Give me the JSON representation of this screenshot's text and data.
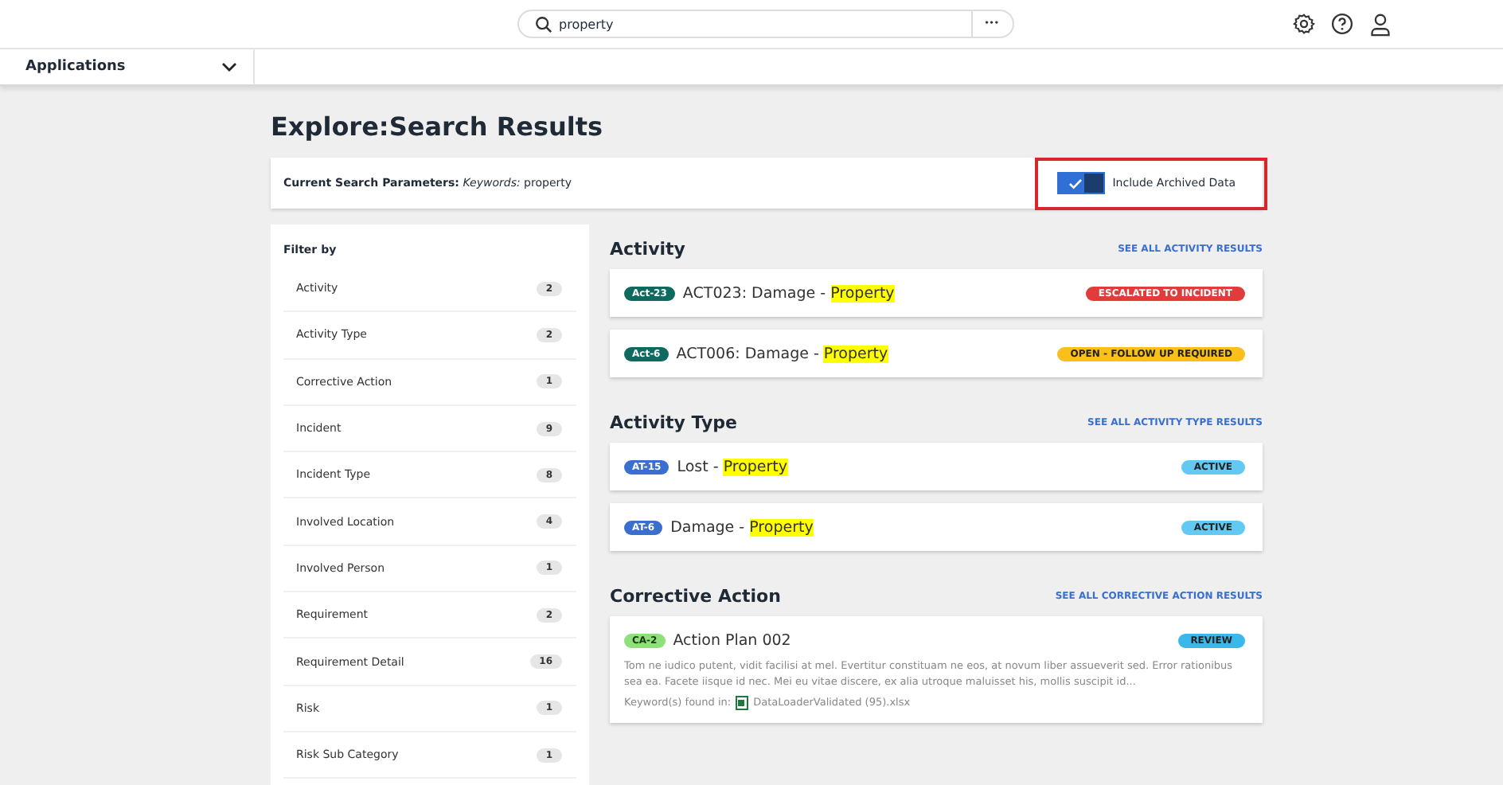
{
  "top_bar": {
    "search": {
      "value": "property",
      "more": "•••"
    }
  },
  "nav": {
    "applications": "Applications"
  },
  "page_title": "Explore:Search Results",
  "search_parameters": {
    "text": "**Current Search Parameters:** *Keywords:* property",
    "toggle": {
      "label": "Include Archived Data",
      "on": true,
      "highlighted": true
    }
  },
  "filter": {
    "title": "Filter by",
    "items": [
      {
        "label": "Activity",
        "count": "2"
      },
      {
        "label": "Activity Type",
        "count": "2"
      },
      {
        "label": "Corrective Action",
        "count": "1"
      },
      {
        "label": "Incident",
        "count": "9"
      },
      {
        "label": "Incident Type",
        "count": "8"
      },
      {
        "label": "Involved Location",
        "count": "4"
      },
      {
        "label": "Involved Person",
        "count": "1"
      },
      {
        "label": "Requirement",
        "count": "2"
      },
      {
        "label": "Requirement Detail",
        "count": "16"
      },
      {
        "label": "Risk",
        "count": "1"
      },
      {
        "label": "Risk Sub Category",
        "count": "1"
      }
    ]
  },
  "sections": [
    {
      "title": "Activity",
      "see_all": "SEE ALL ACTIVITY RESULTS",
      "results": [
        {
          "tag": {
            "label": "Act-23",
            "color": "#0e6a5e"
          },
          "title": "ACT023: Damage - ",
          "highlight": "Property",
          "status": {
            "label": "ESCALATED TO INCIDENT",
            "color": "#e23b3b"
          }
        },
        {
          "tag": {
            "label": "Act-6",
            "color": "#0e6a5e"
          },
          "title": "ACT006: Damage - ",
          "highlight": "Property",
          "status": {
            "label": "OPEN - FOLLOW UP REQUIRED",
            "color": "#f9bf1a"
          }
        }
      ]
    },
    {
      "title": "Activity Type",
      "see_all": "SEE ALL ACTIVITY TYPE RESULTS",
      "results": [
        {
          "tag": {
            "label": "AT-15",
            "color": "#3a6fd0"
          },
          "title": "Lost - ",
          "highlight": "Property",
          "status": {
            "label": "ACTIVE",
            "color": "#62c9f2"
          }
        },
        {
          "tag": {
            "label": "AT-6",
            "color": "#3a6fd0"
          },
          "title": "Damage - ",
          "highlight": "Property",
          "status": {
            "label": "ACTIVE",
            "color": "#62c9f2"
          }
        }
      ]
    },
    {
      "title": "Corrective Action",
      "see_all": "SEE ALL CORRECTIVE ACTION RESULTS",
      "results": [
        {
          "tag": {
            "label": "CA-2",
            "color": "#8fe07a"
          },
          "title": "Action Plan 002",
          "status": {
            "label": "REVIEW",
            "color": "#3ab8ec"
          },
          "description": "Tom ne iudico putent, vidit facilisi at mel. Evertitur constituam ne eos, at novum liber assueverit sed. Error rationibus sea ea. Facete iisque id nec. Mei eu vitae discere, ex alia utroque maluisset his, mollis suscipit id...",
          "keywords_label": "Keyword(s) found in:",
          "file": "DataLoaderValidated (95).xlsx"
        }
      ]
    }
  ]
}
